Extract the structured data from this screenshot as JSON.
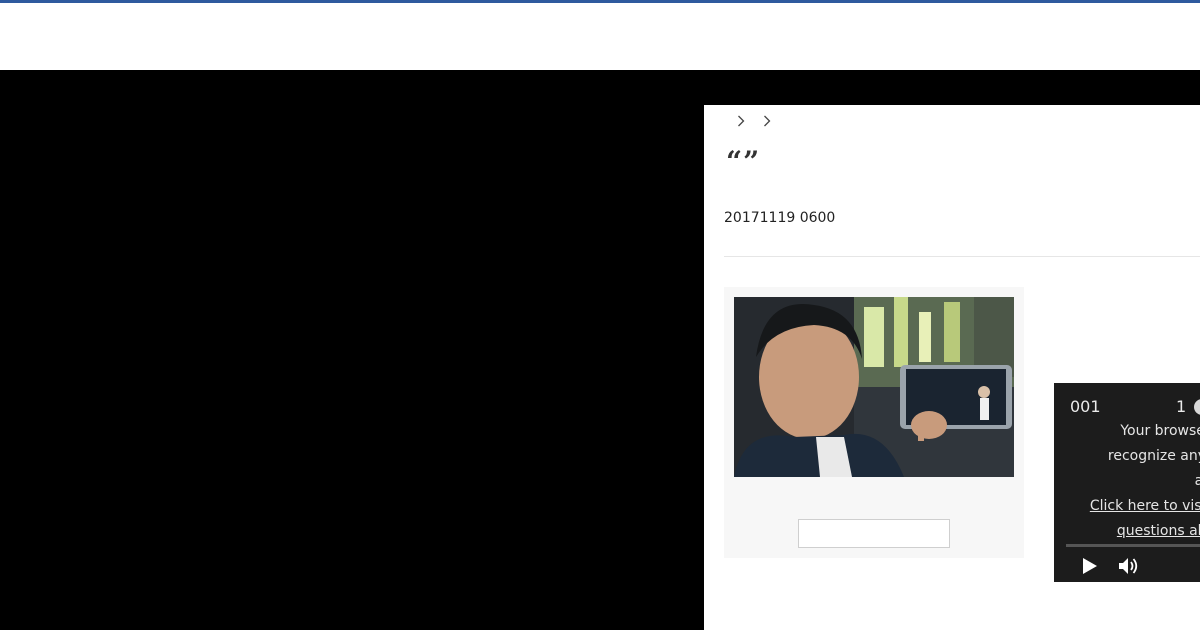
{
  "header": {
    "accent_color": "#2f5a9e"
  },
  "breadcrumb": {
    "separators": [
      "chevron-right-icon",
      "chevron-right-icon"
    ]
  },
  "article": {
    "headline": "“”",
    "timestamp": "20171119 0600"
  },
  "figure": {
    "photo_icon": "photo-image",
    "caption": ""
  },
  "video_player": {
    "counter": "001",
    "index": "1",
    "message_lines": [
      "Your browser d",
      "recognize any of",
      "avai"
    ],
    "link_lines": [
      "Click here to visit o",
      "questions abou"
    ],
    "play_icon": "play-icon",
    "volume_icon": "volume-icon"
  }
}
